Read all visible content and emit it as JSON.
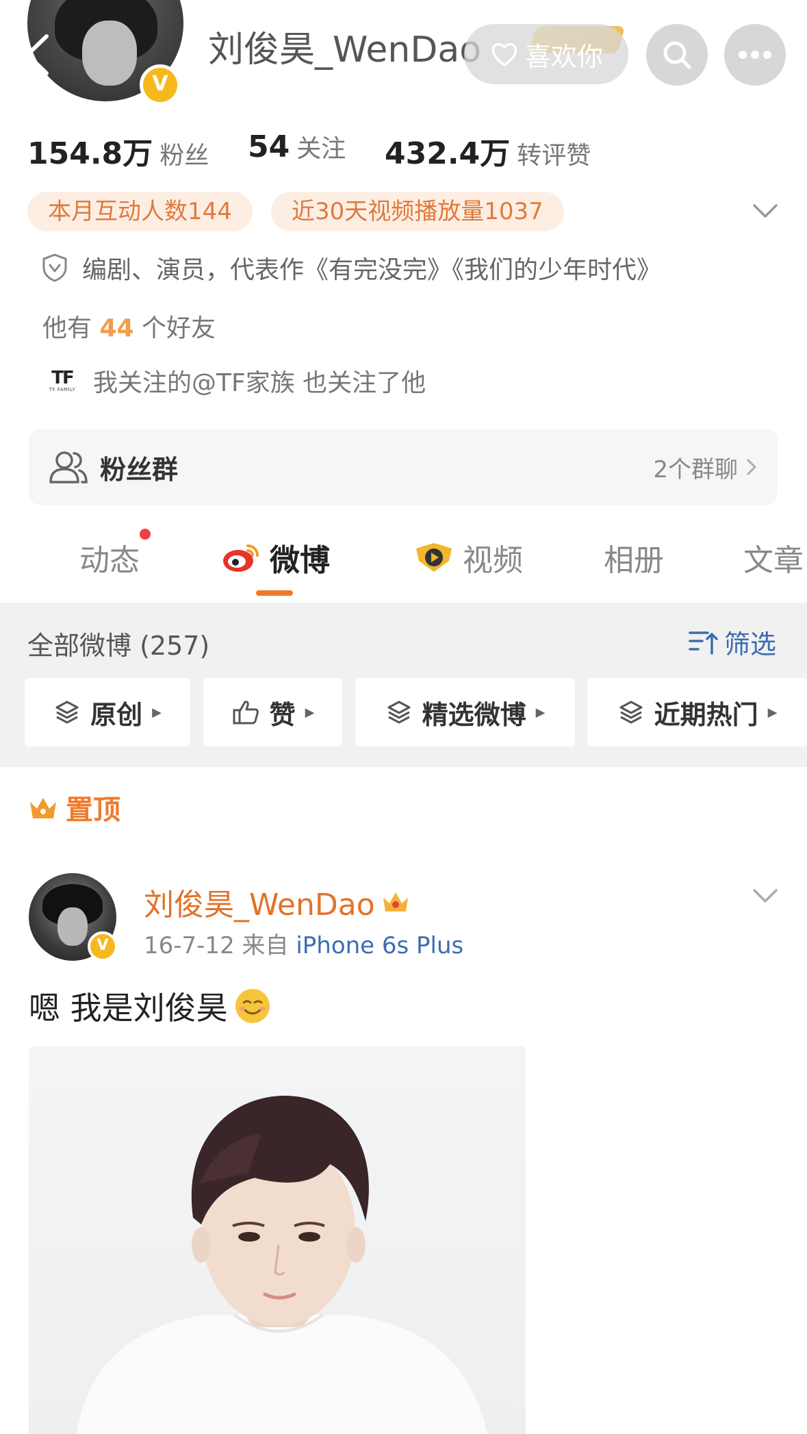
{
  "header": {
    "name": "刘俊昊_WenDao",
    "like_label": "喜欢你",
    "verified_mark": "V"
  },
  "stats": [
    {
      "value": "154.8万",
      "label": "粉丝"
    },
    {
      "value": "54",
      "label": "关注"
    },
    {
      "value": "432.4万",
      "label": "转评赞"
    }
  ],
  "badges": {
    "interact": "本月互动人数144",
    "video_plays": "近30天视频播放量1037"
  },
  "bio": "编剧、演员，代表作《有完没完》《我们的少年时代》",
  "friends": {
    "prefix": "他有",
    "count": "44",
    "suffix": "个好友"
  },
  "mutual": {
    "logo_text": "TF",
    "logo_sub": "TF FAMILY",
    "text": "我关注的@TF家族 也关注了他"
  },
  "fan_group": {
    "label": "粉丝群",
    "count_text": "2个群聊"
  },
  "tabs": [
    "动态",
    "微博",
    "视频",
    "相册",
    "文章"
  ],
  "filter": {
    "title": "全部微博 (257)",
    "filter_label": "筛选",
    "chips": [
      "原创",
      "赞",
      "精选微博",
      "近期热门"
    ]
  },
  "pinned_label": "置顶",
  "post": {
    "author": "刘俊昊_WenDao",
    "date": "16-7-12",
    "from_label": "来自",
    "source": "iPhone 6s Plus",
    "text": "嗯 我是刘俊昊"
  },
  "colors": {
    "accent_orange": "#f07a2a",
    "link_blue": "#3d6db0",
    "verified_gold": "#f5b91e",
    "badge_bg": "#fdeee4"
  },
  "icons": [
    "back-icon",
    "heart-icon",
    "search-icon",
    "more-icon",
    "chevron-down-icon",
    "shield-icon",
    "group-icon",
    "chevron-right-icon",
    "weibo-logo-icon",
    "video-logo-icon",
    "filter-icon",
    "layers-icon",
    "thumb-up-icon",
    "crown-icon",
    "smile-emoji-icon"
  ]
}
